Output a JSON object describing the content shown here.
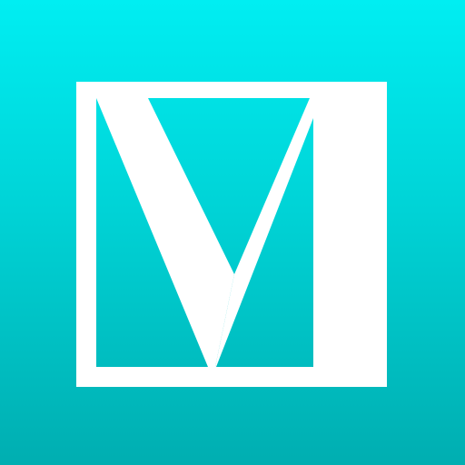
{
  "app_icon": {
    "logo_letter": "M",
    "colors": {
      "background_top": "#00eef2",
      "background_bottom": "#00aeb1",
      "mark": "#ffffff"
    }
  }
}
